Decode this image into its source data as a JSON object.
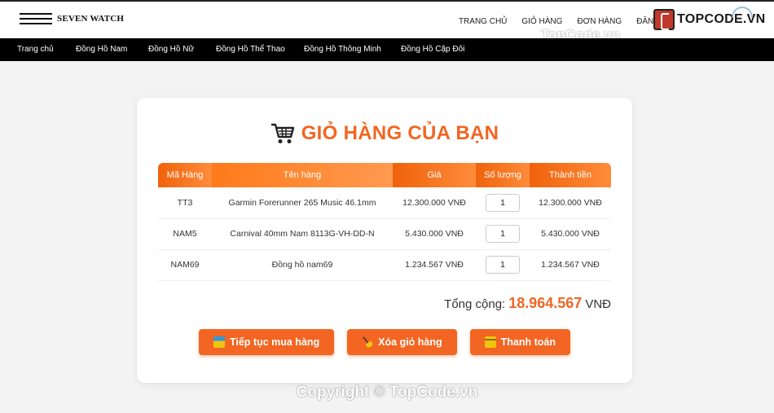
{
  "header": {
    "logo_text": "SEVEN WATCH",
    "nav": [
      "TRANG CHỦ",
      "GIỎ HÀNG",
      "ĐƠN HÀNG",
      "ĐĂNG"
    ]
  },
  "brand": {
    "text": "TOPCODE.VN"
  },
  "watermark": {
    "top": "TopCode.vn",
    "bottom": "Copyright © TopCode.vn"
  },
  "menu": [
    "Trang chủ",
    "Đồng Hồ Nam",
    "Đồng Hồ Nữ",
    "Đồng Hồ Thể Thao",
    "Đồng Hồ Thông Minh",
    "Đồng Hồ Cặp Đôi"
  ],
  "cart": {
    "title": "GIỎ HÀNG CỦA BẠN",
    "columns": [
      "Mã Hàng",
      "Tên hàng",
      "Giá",
      "Số lượng",
      "Thành tiền"
    ],
    "rows": [
      {
        "code": "TT3",
        "name": "Garmin Forerunner 265 Music 46.1mm",
        "price": "12.300.000 VNĐ",
        "qty": "1",
        "subtotal": "12.300.000 VNĐ"
      },
      {
        "code": "NAM5",
        "name": "Carnival 40mm Nam 8113G-VH-DD-N",
        "price": "5.430.000 VNĐ",
        "qty": "1",
        "subtotal": "5.430.000 VNĐ"
      },
      {
        "code": "NAM69",
        "name": "Đồng hồ nam69",
        "price": "1.234.567 VNĐ",
        "qty": "1",
        "subtotal": "1.234.567 VNĐ"
      }
    ],
    "total_label": "Tổng cộng:",
    "total_amount": "18.964.567",
    "total_currency": "VNĐ"
  },
  "actions": {
    "continue": "Tiếp tục mua hàng",
    "clear": "Xóa giỏ hàng",
    "checkout": "Thanh toán"
  },
  "colors": {
    "accent": "#f26522",
    "menubar": "#000000"
  }
}
